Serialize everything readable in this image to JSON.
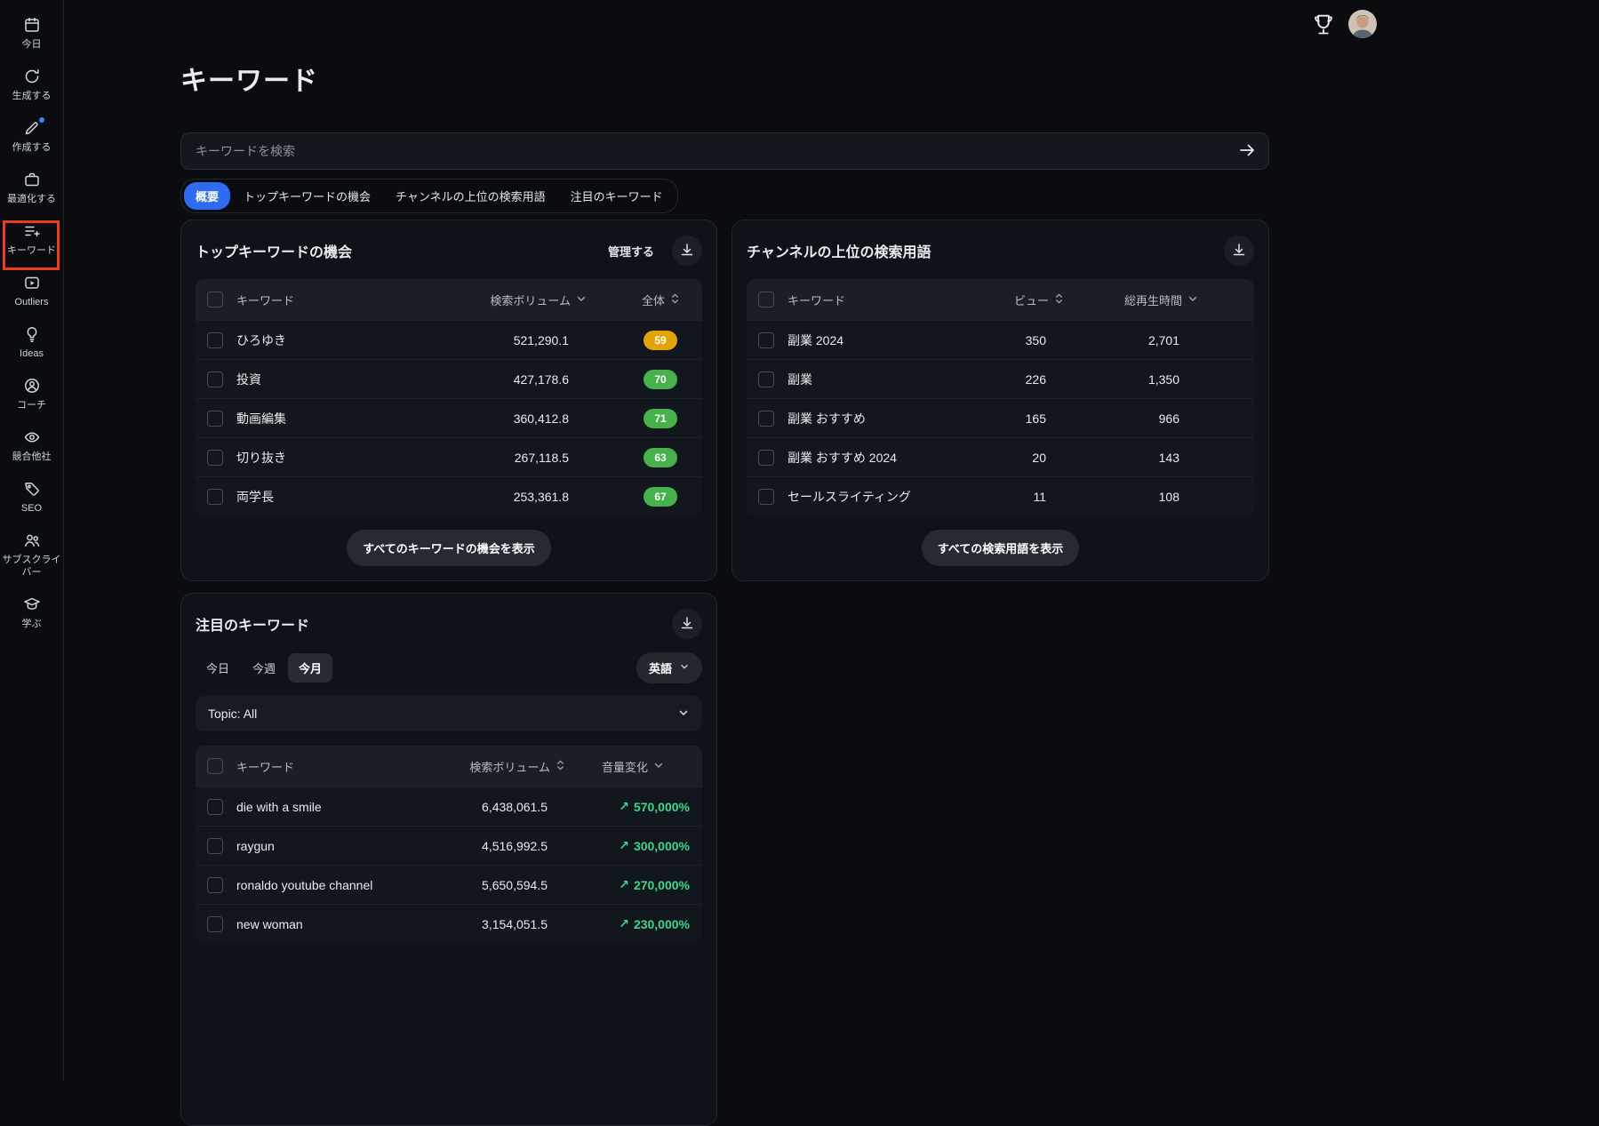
{
  "colors": {
    "accent_blue": "#2E6BF0",
    "badge_green": "#47B24C",
    "badge_yellow": "#E2A408",
    "trend_green": "#3DD68C",
    "annotation_red": "#EA3B23"
  },
  "icons": {
    "trophy": "trophy cup outline",
    "avatar": "user profile photo",
    "download": "arrow-down-to-tray",
    "sort": "up-down chevrons",
    "chevron_down": "chevron down",
    "search_submit": "right arrow",
    "trend_up": "up-right arrow"
  },
  "sidebar": {
    "items": [
      {
        "label": "今日",
        "icon": "calendar-icon"
      },
      {
        "label": "生成する",
        "icon": "generate-icon"
      },
      {
        "label": "作成する",
        "icon": "create-icon"
      },
      {
        "label": "最適化する",
        "icon": "optimize-icon"
      },
      {
        "label": "キーワード",
        "icon": "keywords-icon"
      },
      {
        "label": "Outliers",
        "icon": "outliers-icon"
      },
      {
        "label": "Ideas",
        "icon": "ideas-icon"
      },
      {
        "label": "コーチ",
        "icon": "coach-icon"
      },
      {
        "label": "競合他社",
        "icon": "competitors-icon"
      },
      {
        "label": "SEO",
        "icon": "seo-icon"
      },
      {
        "label": "サブスクライバー",
        "icon": "subscribers-icon"
      },
      {
        "label": "学ぶ",
        "icon": "learn-icon"
      }
    ]
  },
  "page": {
    "title": "キーワード"
  },
  "search": {
    "placeholder": "キーワードを検索"
  },
  "tabs": {
    "items": [
      {
        "label": "概要",
        "active": true
      },
      {
        "label": "トップキーワードの機会",
        "active": false
      },
      {
        "label": "チャンネルの上位の検索用語",
        "active": false
      },
      {
        "label": "注目のキーワード",
        "active": false
      }
    ]
  },
  "cards": {
    "top_opportunities": {
      "title": "トップキーワードの機会",
      "manage_label": "管理する",
      "columns": {
        "keyword": "キーワード",
        "volume": "検索ボリューム",
        "overall": "全体"
      },
      "rows": [
        {
          "keyword": "ひろゆき",
          "volume": "521,290.1",
          "score": "59",
          "tone": "yellow"
        },
        {
          "keyword": "投資",
          "volume": "427,178.6",
          "score": "70",
          "tone": "green"
        },
        {
          "keyword": "動画編集",
          "volume": "360,412.8",
          "score": "71",
          "tone": "green"
        },
        {
          "keyword": "切り抜き",
          "volume": "267,118.5",
          "score": "63",
          "tone": "green"
        },
        {
          "keyword": "両学長",
          "volume": "253,361.8",
          "score": "67",
          "tone": "green"
        }
      ],
      "footer_button": "すべてのキーワードの機会を表示"
    },
    "channel_terms": {
      "title": "チャンネルの上位の検索用語",
      "columns": {
        "keyword": "キーワード",
        "views": "ビュー",
        "watch_time": "総再生時間"
      },
      "rows": [
        {
          "keyword": "副業 2024",
          "views": "350",
          "watch_time": "2,701"
        },
        {
          "keyword": "副業",
          "views": "226",
          "watch_time": "1,350"
        },
        {
          "keyword": "副業 おすすめ",
          "views": "165",
          "watch_time": "966"
        },
        {
          "keyword": "副業 おすすめ 2024",
          "views": "20",
          "watch_time": "143"
        },
        {
          "keyword": "セールスライティング",
          "views": "11",
          "watch_time": "108"
        }
      ],
      "footer_button": "すべての検索用語を表示"
    },
    "trending": {
      "title": "注目のキーワード",
      "period_tabs": [
        {
          "label": "今日",
          "active": false
        },
        {
          "label": "今週",
          "active": false
        },
        {
          "label": "今月",
          "active": true
        }
      ],
      "language": "英語",
      "topic": "Topic: All",
      "columns": {
        "keyword": "キーワード",
        "volume": "検索ボリューム",
        "change": "音量変化"
      },
      "trend_arrow": "↗",
      "rows": [
        {
          "keyword": "die with a smile",
          "volume": "6,438,061.5",
          "change": "570,000%"
        },
        {
          "keyword": "raygun",
          "volume": "4,516,992.5",
          "change": "300,000%"
        },
        {
          "keyword": "ronaldo youtube channel",
          "volume": "5,650,594.5",
          "change": "270,000%"
        },
        {
          "keyword": "new woman",
          "volume": "3,154,051.5",
          "change": "230,000%"
        }
      ]
    }
  }
}
